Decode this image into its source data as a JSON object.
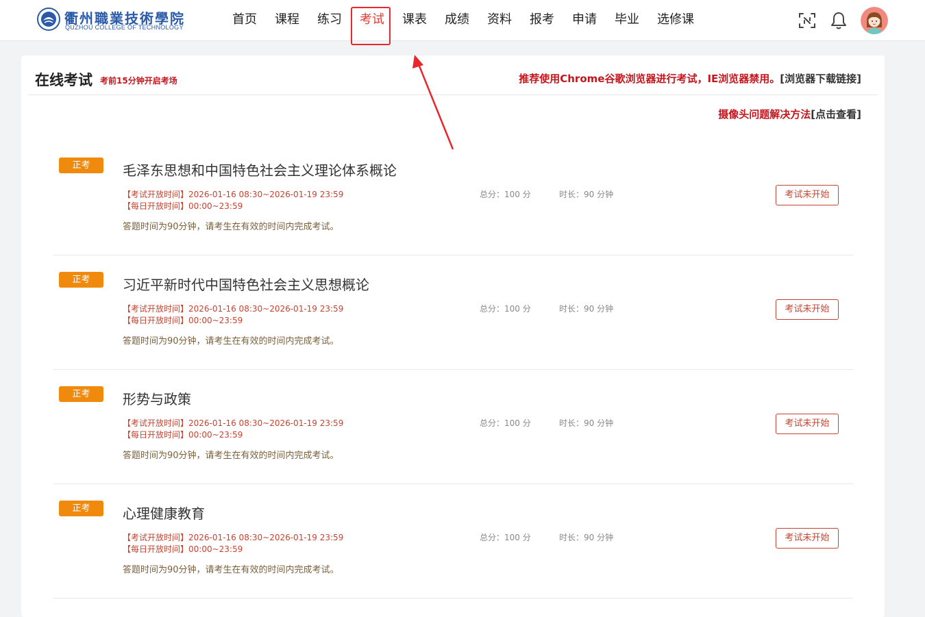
{
  "header": {
    "logo_cn": "衢州職業技術學院",
    "logo_en": "QUZHOU COLLEGE OF TECHNOLOGY",
    "nav": [
      {
        "label": "首页"
      },
      {
        "label": "课程"
      },
      {
        "label": "练习"
      },
      {
        "label": "考试",
        "active": true
      },
      {
        "label": "课表"
      },
      {
        "label": "成绩"
      },
      {
        "label": "资料"
      },
      {
        "label": "报考"
      },
      {
        "label": "申请"
      },
      {
        "label": "毕业"
      },
      {
        "label": "选修课"
      }
    ],
    "icons": [
      "scan-icon",
      "bell-icon",
      "avatar"
    ]
  },
  "page": {
    "title": "在线考试",
    "subtitle": "考前15分钟开启考场",
    "browser_tip": "推荐使用Chrome谷歌浏览器进行考试，IE浏览器禁用。",
    "browser_link": "[浏览器下载链接]",
    "camera_tip": "摄像头问题解决方法",
    "camera_link": "[点击查看]"
  },
  "exams": [
    {
      "badge": "正考",
      "title": "毛泽东思想和中国特色社会主义理论体系概论",
      "open_time": "【考试开放时间】2026-01-16 08:30~2026-01-19 23:59",
      "daily_time": "【每日开放时间】00:00~23:59",
      "score": "总分：100 分",
      "duration": "时长：90 分钟",
      "note": "答题时间为90分钟，请考生在有效的时间内完成考试。",
      "status": "考试未开始"
    },
    {
      "badge": "正考",
      "title": "习近平新时代中国特色社会主义思想概论",
      "open_time": "【考试开放时间】2026-01-16 08:30~2026-01-19 23:59",
      "daily_time": "【每日开放时间】00:00~23:59",
      "score": "总分：100 分",
      "duration": "时长：90 分钟",
      "note": "答题时间为90分钟，请考生在有效的时间内完成考试。",
      "status": "考试未开始"
    },
    {
      "badge": "正考",
      "title": "形势与政策",
      "open_time": "【考试开放时间】2026-01-16 08:30~2026-01-19 23:59",
      "daily_time": "【每日开放时间】00:00~23:59",
      "score": "总分：100 分",
      "duration": "时长：90 分钟",
      "note": "答题时间为90分钟，请考生在有效的时间内完成考试。",
      "status": "考试未开始"
    },
    {
      "badge": "正考",
      "title": "心理健康教育",
      "open_time": "【考试开放时间】2026-01-16 08:30~2026-01-19 23:59",
      "daily_time": "【每日开放时间】00:00~23:59",
      "score": "总分：100 分",
      "duration": "时长：90 分钟",
      "note": "答题时间为90分钟，请考生在有效的时间内完成考试。",
      "status": "考试未开始"
    }
  ],
  "colors": {
    "accent_red": "#c5161d",
    "badge_orange": "#ef8a0c",
    "highlight_box": "#e8262b",
    "brand_blue": "#2a5aa8"
  }
}
